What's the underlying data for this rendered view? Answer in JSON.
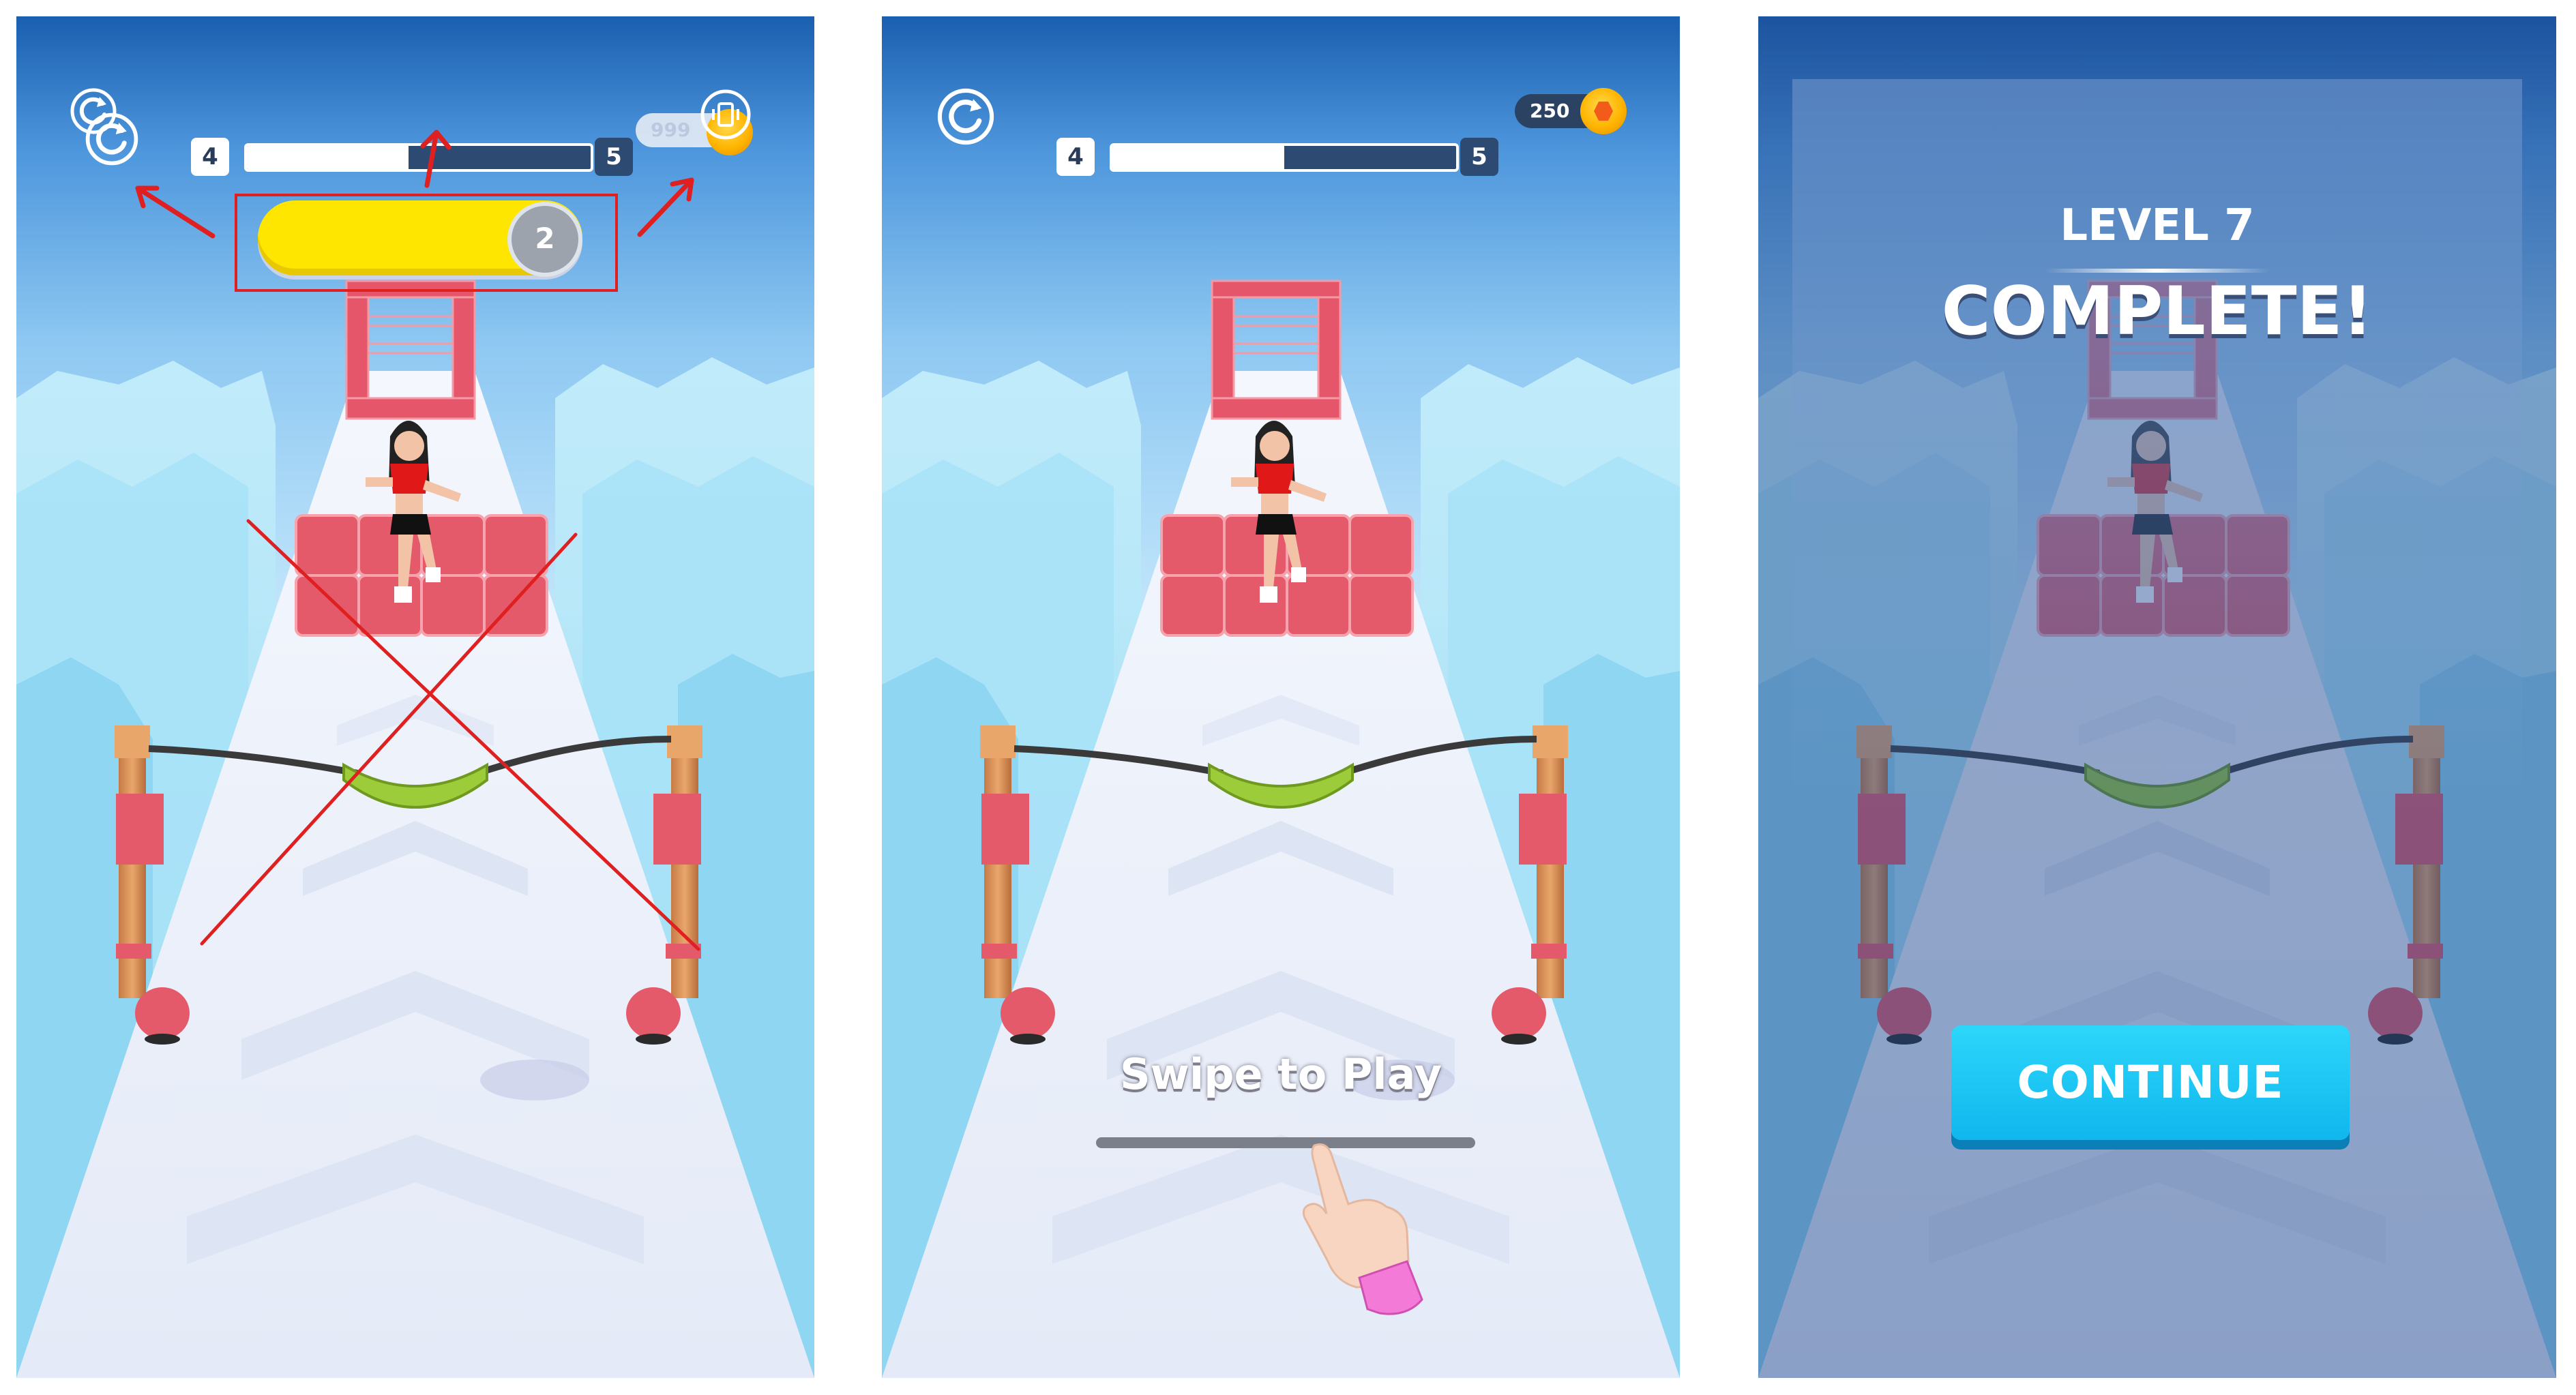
{
  "panels": [
    {
      "id": "before",
      "hud": {
        "level_current": "4",
        "level_next": "5",
        "coins": "999",
        "count_badge": "2",
        "progress_fraction": 0.47
      },
      "annotations": {
        "red_box": "highlight-count-bar",
        "red_arrows": 3,
        "red_cross": "rejected-design"
      }
    },
    {
      "id": "start",
      "hud": {
        "level_current": "4",
        "level_next": "5",
        "coins": "250",
        "progress_fraction": 0.5
      },
      "prompt": "Swipe to Play",
      "icons": [
        "restart-icon",
        "coin-icon",
        "pointing-hand-icon"
      ]
    },
    {
      "id": "complete",
      "title_line1": "LEVEL 7",
      "title_line2": "COMPLETE!",
      "continue_label": "CONTINUE"
    }
  ],
  "colors": {
    "brick": "#e85b6b",
    "track": "#eef3fb",
    "sky_top": "#1a5fb0",
    "accent_yellow": "#ffe600",
    "continue_button": "#14c2f5",
    "annotation_red": "#e02020",
    "sleeve_pink": "#f47ad8",
    "slingshot_post": "#d9935a",
    "slingshot_pad": "#9ccc3a"
  }
}
